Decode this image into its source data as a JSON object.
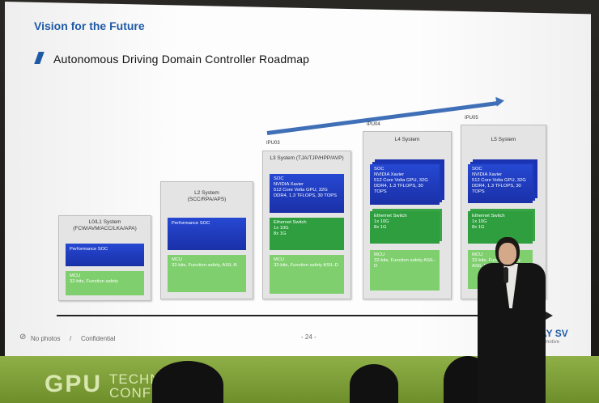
{
  "slide": {
    "section_title": "Vision for the Future",
    "title": "Autonomous Driving Domain Controller Roadmap",
    "footer": {
      "no_photos": "No photos",
      "separator": "/",
      "confidential": "Confidential",
      "page_number": "- 24 -"
    },
    "logo_main": "SAY SV",
    "logo_sub": "omotive"
  },
  "systems": [
    {
      "tag": "",
      "title_line1": "L0/L1 System",
      "title_line2": "(FCW/AVM/ACC/LKA/APA)",
      "compute": "Performance SOC",
      "ethernet": "",
      "mcu_line1": "MCU",
      "mcu_line2": "32-bits, Function safety"
    },
    {
      "tag": "",
      "title_line1": "L2 System",
      "title_line2": "(SCC/RPA/APS)",
      "compute": "Performance SOC",
      "ethernet": "",
      "mcu_line1": "MCU",
      "mcu_line2": "32-bits, Function safety, ASIL-B"
    },
    {
      "tag": "IPU03",
      "title_line1": "L3 System (TJA/TJP/HPP/AVP)",
      "title_line2": "",
      "soc_lines": [
        "SOC",
        "NVIDIA Xavier",
        "512 Core Volta GPU, 32G",
        "DDR4, 1.3 TFLOPS, 30 TOPS"
      ],
      "eth_lines": [
        "Ethernet Switch",
        "1x 10G",
        "8x 1G"
      ],
      "mcu_line1": "MCU",
      "mcu_line2": "32-bits, Function safety ASIL-D"
    },
    {
      "tag": "IPU04",
      "title_line1": "L4 System",
      "title_line2": "",
      "soc_lines": [
        "SOC",
        "NVIDIA Xavier",
        "512 Core Volta GPU, 32G",
        "DDR4, 1.3 TFLOPS, 30 TOPS"
      ],
      "eth_lines": [
        "Ethernet Switch",
        "1x 10G",
        "8x 1G"
      ],
      "mcu_line1": "MCU",
      "mcu_line2": "32-bits, Function safety ASIL-D"
    },
    {
      "tag": "IPU05",
      "title_line1": "L5 System",
      "title_line2": "",
      "soc_lines": [
        "SOC",
        "NVIDIA Xavier",
        "512 Core Volta GPU, 32G",
        "DDR4, 1.3 TFLOPS, 30 TOPS"
      ],
      "eth_lines": [
        "Ethernet Switch",
        "1x 10G",
        "8x 1G"
      ],
      "mcu_line1": "MCU",
      "mcu_line2": "32-bits, Function safety ASIL-D"
    }
  ],
  "banner": {
    "gpu": "GPU",
    "tech_line1": "TECHNO",
    "tech_line2": "CONFE"
  },
  "colors": {
    "accent_blue": "#1f5aa6",
    "soc_blue": "#2040c8",
    "eth_green": "#2e9e3e",
    "mcu_green": "#7fcf6e",
    "banner_green": "#8fb048"
  }
}
